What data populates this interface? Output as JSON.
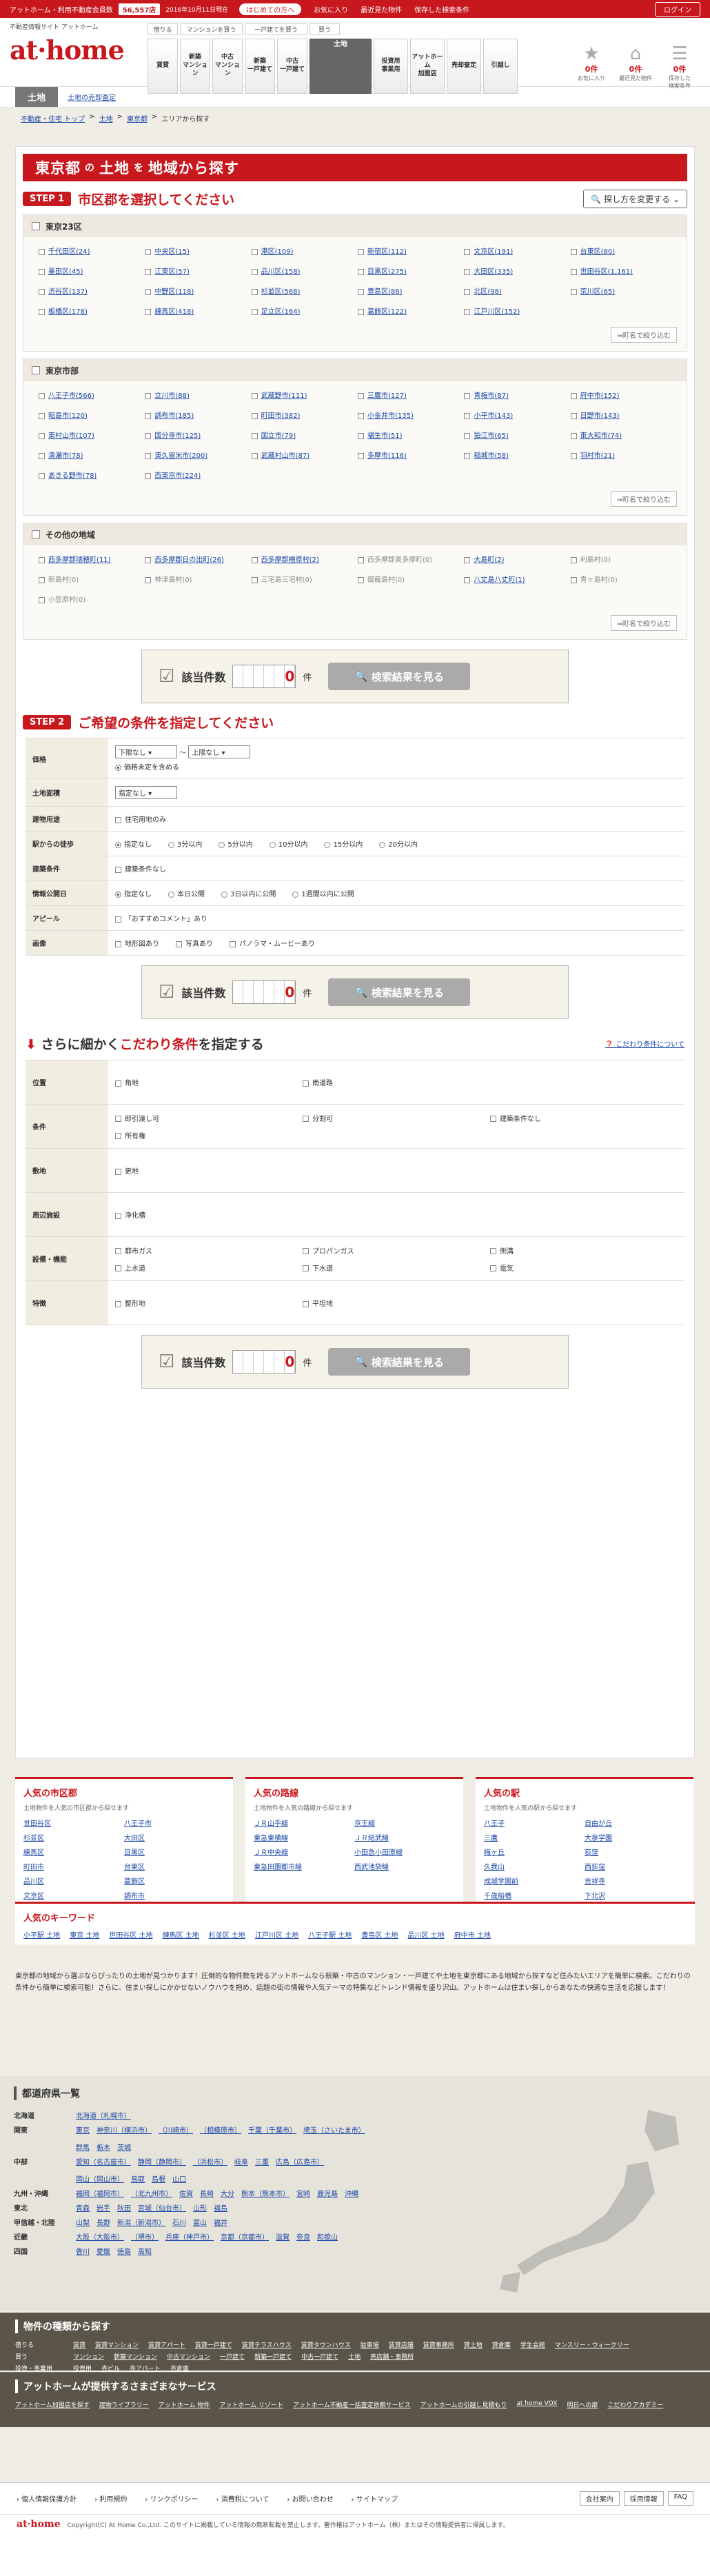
{
  "topbar": {
    "site_desc": "アットホーム・利用不動産会員数",
    "count": "56,557店",
    "date": "2016年10月11日現在",
    "hajime": "はじめての方へ",
    "links": [
      "お気に入り",
      "最近見た物件",
      "保存した検索条件"
    ],
    "login": "ログイン"
  },
  "header": {
    "tagline": "不動産情報サイト アットホーム",
    "logo": "at·home",
    "groups": [
      "借りる",
      "マンションを買う",
      "一戸建てを買う",
      "買う"
    ],
    "nav": [
      "賃貸",
      "新築\nマンション",
      "中古\nマンション",
      "新築\n一戸建て",
      "中古\n一戸建て",
      "土地",
      "投資用\n事業用",
      "アットホーム\n加盟店",
      "売却査定",
      "引越し"
    ],
    "icons": [
      {
        "n": "0件",
        "l": "お気に入り"
      },
      {
        "n": "0件",
        "l": "最近見た物件"
      },
      {
        "n": "0件",
        "l": "保存した\n検索条件"
      }
    ]
  },
  "catbar": {
    "cat": "土地",
    "sub": "土地の売却査定"
  },
  "breadcrumb": [
    "不動産・住宅 トップ",
    "土地",
    "東京都",
    "エリアから探す"
  ],
  "title": {
    "pref": "東京都",
    "p1": "の",
    "kind": "土地",
    "p2": "を",
    "rest": "地域から探す"
  },
  "step1": {
    "badge": "STEP 1",
    "text": "市区郡を選択してください",
    "change": "探し方を変更する"
  },
  "areas": [
    {
      "name": "東京23区",
      "items": [
        "千代田区(24)",
        "中央区(15)",
        "港区(109)",
        "新宿区(112)",
        "文京区(191)",
        "台東区(80)",
        "墨田区(45)",
        "江東区(57)",
        "品川区(158)",
        "目黒区(275)",
        "大田区(335)",
        "世田谷区(1,161)",
        "渋谷区(137)",
        "中野区(118)",
        "杉並区(568)",
        "豊島区(86)",
        "北区(98)",
        "荒川区(65)",
        "板橋区(178)",
        "練馬区(418)",
        "足立区(164)",
        "葛飾区(122)",
        "江戸川区(152)"
      ]
    },
    {
      "name": "東京市部",
      "items": [
        "八王子市(566)",
        "立川市(88)",
        "武蔵野市(111)",
        "三鷹市(127)",
        "青梅市(87)",
        "府中市(152)",
        "昭島市(120)",
        "調布市(185)",
        "町田市(382)",
        "小金井市(135)",
        "小平市(143)",
        "日野市(143)",
        "東村山市(107)",
        "国分寺市(125)",
        "国立市(79)",
        "福生市(51)",
        "狛江市(65)",
        "東大和市(74)",
        "清瀬市(78)",
        "東久留米市(200)",
        "武蔵村山市(87)",
        "多摩市(116)",
        "稲城市(58)",
        "羽村市(21)",
        "あきる野市(78)",
        "西東京市(224)"
      ]
    },
    {
      "name": "その他の地域",
      "items": [
        "西多摩郡瑞穂町(11)",
        "西多摩郡日の出町(26)",
        "西多摩郡檜原村(2)",
        "西多摩郡奥多摩町(0)",
        "大島町(2)",
        "利島村(0)",
        "新島村(0)",
        "神津島村(0)",
        "三宅島三宅村(0)",
        "御蔵島村(0)",
        "八丈島八丈町(1)",
        "青ヶ島村(0)",
        "小笠原村(0)"
      ],
      "inactive": [
        3,
        5,
        6,
        7,
        8,
        9,
        11,
        12
      ]
    }
  ],
  "narrow": "⇒町名で絞り込む",
  "countbar": {
    "label": "該当件数",
    "value": "0",
    "unit": "件",
    "btn": "検索結果を見る"
  },
  "step2": {
    "badge": "STEP 2",
    "text": "ご希望の条件を指定してください"
  },
  "conds": {
    "price": {
      "label": "価格",
      "min": "下限なし",
      "tilde": "〜",
      "max": "上限なし",
      "incl": "価格未定を含める"
    },
    "area": {
      "label": "土地面積",
      "val": "指定なし"
    },
    "use": {
      "label": "建物用途",
      "opt": "住宅用地のみ"
    },
    "walk": {
      "label": "駅からの徒歩",
      "opts": [
        "指定なし",
        "3分以内",
        "5分以内",
        "10分以内",
        "15分以内",
        "20分以内"
      ]
    },
    "joint": {
      "label": "建築条件",
      "opt": "建築条件なし"
    },
    "pub": {
      "label": "情報公開日",
      "opts": [
        "指定なし",
        "本日公開",
        "3日以内に公開",
        "1週間以内に公開"
      ]
    },
    "appeal": {
      "label": "アピール",
      "opt": "「おすすめコメント」あり"
    },
    "img": {
      "label": "画像",
      "opts": [
        "地形図あり",
        "写真あり",
        "パノラマ・ムービーあり"
      ]
    }
  },
  "kodawari": {
    "pre": "さらに細かく",
    "red": "こだわり条件",
    "post": "を指定する",
    "link": "こだわり条件について",
    "rows": [
      {
        "label": "位置",
        "opts": [
          "角地",
          "南道路"
        ]
      },
      {
        "label": "条件",
        "opts": [
          "即引渡し可",
          "分割可",
          "建築条件なし",
          "所有権"
        ]
      },
      {
        "label": "敷地",
        "opts": [
          "更地"
        ]
      },
      {
        "label": "周辺施設",
        "opts": [
          "浄化槽"
        ]
      },
      {
        "label": "設備・機能",
        "opts": [
          "都市ガス",
          "プロパンガス",
          "側溝",
          "上水道",
          "下水道",
          "電気"
        ]
      },
      {
        "label": "特徴",
        "opts": [
          "整形地",
          "平坦地"
        ]
      }
    ]
  },
  "popular": [
    {
      "title": "人気の市区郡",
      "sub": "土地物件を人気の市区郡から探せます",
      "items": [
        "世田谷区",
        "八王子市",
        "杉並区",
        "大田区",
        "練馬区",
        "目黒区",
        "町田市",
        "台東区",
        "品川区",
        "葛飾区",
        "文京区",
        "調布市"
      ]
    },
    {
      "title": "人気の路線",
      "sub": "土地物件を人気の路線から探せます",
      "items": [
        "ＪＲ山手線",
        "京王線",
        "東急東横線",
        "ＪＲ総武線",
        "ＪＲ中央線",
        "小田急小田原線",
        "東急田園都市線",
        "西武池袋線"
      ]
    },
    {
      "title": "人気の駅",
      "sub": "土地物件を人気の駅から探せます",
      "items": [
        "八王子",
        "自由が丘",
        "三鷹",
        "大泉学園",
        "梅ヶ丘",
        "荻窪",
        "久我山",
        "西荻窪",
        "成城学園前",
        "吉祥寺",
        "千歳船橋",
        "下北沢",
        "千歳烏山"
      ]
    }
  ],
  "keywords": {
    "title": "人気のキーワード",
    "items": [
      "小平駅 土地",
      "東京 土地",
      "世田谷区 土地",
      "練馬区 土地",
      "杉並区 土地",
      "江戸川区 土地",
      "八王子駅 土地",
      "豊島区 土地",
      "品川区 土地",
      "府中市 土地"
    ]
  },
  "desc": "東京都の地域から選ぶならぴったりの土地が見つかります！圧倒的な物件数を誇るアットホームなら新築・中古のマンション・一戸建てや土地を東京都にある地域から探すなど住みたいエリアを簡単に検索。こだわりの条件から簡単に検索可能！さらに、住まい探しにかかせないノウハウを抱め、話題の街の情報や人気テーマの特集などトレンド情報を盛り沢山。アットホームは住まい探しからあなたの快適な生活を応援します！",
  "prefs": {
    "title": "都道府県一覧",
    "rows": [
      {
        "r": "北海道",
        "p": [
          "北海道（札幌市）"
        ]
      },
      {
        "r": "関東",
        "p": [
          "東京",
          "神奈川（横浜市）",
          "（川崎市）",
          "（相模原市）",
          "千葉（千葉市）",
          "埼玉（さいたま市）",
          "群馬",
          "栃木",
          "茨城"
        ]
      },
      {
        "r": "中部",
        "p": [
          "愛知（名古屋市）",
          "静岡（静岡市）",
          "（浜松市）",
          "岐阜",
          "三重",
          "広島（広島市）",
          "岡山（岡山市）",
          "鳥取",
          "島根",
          "山口"
        ]
      },
      {
        "r": "九州・沖縄",
        "p": [
          "福岡（福岡市）",
          "（北九州市）",
          "佐賀",
          "長崎",
          "大分",
          "熊本（熊本市）",
          "宮崎",
          "鹿児島",
          "沖縄"
        ]
      },
      {
        "r": "東北",
        "p": [
          "青森",
          "岩手",
          "秋田",
          "宮城（仙台市）",
          "山形",
          "福島"
        ]
      },
      {
        "r": "甲信越・北陸",
        "p": [
          "山梨",
          "長野",
          "新潟（新潟市）",
          "石川",
          "富山",
          "福井"
        ]
      },
      {
        "r": "近畿",
        "p": [
          "大阪（大阪市）",
          "（堺市）",
          "兵庫（神戸市）",
          "京都（京都市）",
          "滋賀",
          "奈良",
          "和歌山"
        ]
      },
      {
        "r": "四国",
        "p": [
          "香川",
          "愛媛",
          "徳島",
          "高知"
        ]
      }
    ]
  },
  "bukken": {
    "title": "物件の種類から探す",
    "rows": [
      {
        "r": "借りる",
        "p": [
          "賃貸",
          "賃貸マンション",
          "賃貸アパート",
          "賃貸一戸建て",
          "賃貸テラスハウス",
          "賃貸タウンハウス",
          "駐車場",
          "賃貸店舗",
          "賃貸事務所",
          "貸土地",
          "貸倉庫",
          "学生会館",
          "マンスリー・ウィークリー"
        ]
      },
      {
        "r": "買う",
        "p": [
          "マンション",
          "新築マンション",
          "中古マンション",
          "一戸建て",
          "新築一戸建て",
          "中古一戸建て",
          "土地",
          "売店舗・事務所"
        ]
      },
      {
        "r": "投資・事業用",
        "p": [
          "投資用",
          "売ビル",
          "売アパート",
          "売倉庫"
        ]
      }
    ]
  },
  "service": {
    "title": "アットホームが提供するさまざまなサービス",
    "items": [
      "アットホーム加盟店を探す",
      "建物ライブラリー",
      "アットホーム 物件",
      "アットホーム リゾート",
      "アットホーム不動産一括査定依頼サービス",
      "アットホームの引越し見積もり",
      "at home VOX",
      "明日への扉",
      "こだわりアカデミー"
    ]
  },
  "footer": {
    "links": [
      "個人情報保護方針",
      "利用規約",
      "リンクポリシー",
      "消費税について",
      "お問い合わせ",
      "サイトマップ"
    ],
    "right": [
      "会社案内",
      "採用情報",
      "FAQ"
    ],
    "logo": "at·home",
    "copy": "Copyright(C) At Home Co.,Ltd. このサイトに掲載している情報の無断転載を禁止します。著作権はアットホーム（株）またはその情報提供者に帰属します。"
  }
}
